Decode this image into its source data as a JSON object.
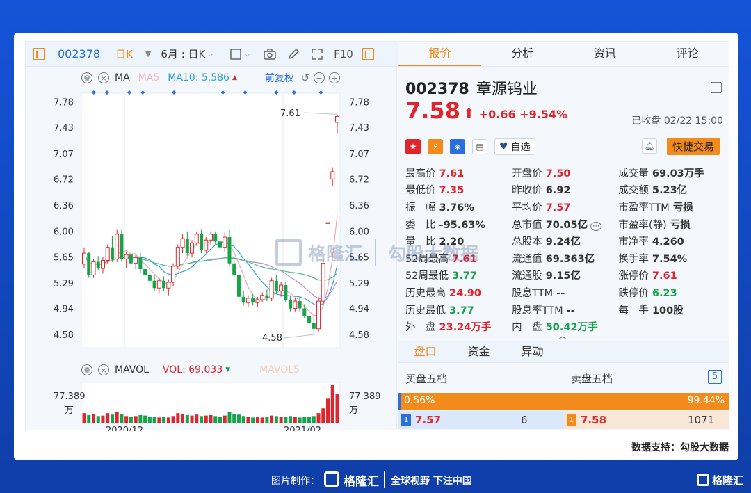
{
  "toolbar": {
    "code": "002378",
    "period": "日K",
    "range": "6月 : 日K",
    "f10": "F10"
  },
  "ma_bar": {
    "label": "MA",
    "ma5": "MA5",
    "ma10": "MA10: 5.586",
    "restore": "前复权"
  },
  "vol_bar": {
    "label": "MAVOL",
    "vol": "VOL: 69.033",
    "mavol5": "MAVOL5"
  },
  "chart_data": {
    "type": "candlestick",
    "y_ticks": [
      "7.78",
      "7.43",
      "7.07",
      "6.72",
      "6.36",
      "6.00",
      "5.65",
      "5.29",
      "4.94",
      "4.58"
    ],
    "ylim": [
      4.4,
      7.9
    ],
    "x_labels": [
      "2020/12",
      "2021/02"
    ],
    "annot_high": "7.61",
    "annot_low": "4.58",
    "vol_tick": "77.389",
    "vol_unit": "万",
    "candles": [
      [
        5.55,
        5.78,
        5.49,
        5.7
      ],
      [
        5.7,
        5.72,
        5.36,
        5.4
      ],
      [
        5.4,
        5.62,
        5.36,
        5.58
      ],
      [
        5.58,
        5.66,
        5.46,
        5.49
      ],
      [
        5.49,
        5.65,
        5.42,
        5.6
      ],
      [
        5.6,
        5.82,
        5.56,
        5.78
      ],
      [
        5.78,
        5.94,
        5.58,
        5.62
      ],
      [
        5.62,
        6.02,
        5.58,
        5.96
      ],
      [
        5.96,
        6.02,
        5.58,
        5.62
      ],
      [
        5.62,
        5.72,
        5.5,
        5.68
      ],
      [
        5.68,
        5.75,
        5.52,
        5.56
      ],
      [
        5.56,
        5.68,
        5.48,
        5.64
      ],
      [
        5.64,
        5.7,
        5.42,
        5.48
      ],
      [
        5.48,
        5.55,
        5.36,
        5.4
      ],
      [
        5.4,
        5.5,
        5.28,
        5.32
      ],
      [
        5.32,
        5.4,
        5.18,
        5.22
      ],
      [
        5.22,
        5.36,
        5.14,
        5.32
      ],
      [
        5.32,
        5.38,
        5.18,
        5.22
      ],
      [
        5.22,
        5.34,
        5.12,
        5.3
      ],
      [
        5.3,
        5.56,
        5.24,
        5.52
      ],
      [
        5.52,
        5.82,
        5.48,
        5.78
      ],
      [
        5.78,
        5.96,
        5.7,
        5.9
      ],
      [
        5.9,
        6.0,
        5.66,
        5.7
      ],
      [
        5.7,
        5.88,
        5.64,
        5.84
      ],
      [
        5.84,
        6.0,
        5.8,
        5.96
      ],
      [
        5.96,
        6.02,
        5.7,
        5.74
      ],
      [
        5.74,
        5.92,
        5.7,
        5.88
      ],
      [
        5.88,
        6.0,
        5.82,
        5.96
      ],
      [
        5.96,
        6.0,
        5.82,
        5.86
      ],
      [
        5.86,
        5.94,
        5.74,
        5.78
      ],
      [
        5.78,
        5.98,
        5.72,
        5.92
      ],
      [
        5.92,
        6.02,
        5.52,
        5.56
      ],
      [
        5.56,
        5.6,
        5.36,
        5.4
      ],
      [
        5.4,
        5.44,
        5.06,
        5.1
      ],
      [
        5.1,
        5.18,
        4.98,
        5.02
      ],
      [
        5.02,
        5.12,
        4.96,
        5.08
      ],
      [
        5.08,
        5.14,
        4.98,
        5.02
      ],
      [
        5.02,
        5.1,
        4.96,
        5.06
      ],
      [
        5.06,
        5.16,
        5.02,
        5.12
      ],
      [
        5.12,
        5.2,
        5.04,
        5.08
      ],
      [
        5.08,
        5.36,
        5.04,
        5.32
      ],
      [
        5.32,
        5.4,
        5.14,
        5.18
      ],
      [
        5.18,
        5.3,
        5.1,
        5.26
      ],
      [
        5.26,
        5.3,
        5.02,
        5.06
      ],
      [
        5.06,
        5.12,
        4.9,
        4.94
      ],
      [
        4.94,
        5.08,
        4.9,
        5.04
      ],
      [
        5.04,
        5.1,
        4.9,
        4.94
      ],
      [
        4.94,
        5.0,
        4.8,
        4.84
      ],
      [
        4.84,
        4.92,
        4.7,
        4.74
      ],
      [
        4.74,
        4.84,
        4.58,
        4.66
      ],
      [
        4.66,
        5.1,
        4.62,
        5.04
      ],
      [
        5.04,
        5.62,
        5.0,
        5.56
      ],
      [
        6.12,
        6.14,
        6.1,
        6.12
      ],
      [
        6.72,
        6.88,
        6.62,
        6.82
      ],
      [
        7.5,
        7.61,
        7.35,
        7.58
      ]
    ],
    "volumes": [
      20,
      16,
      18,
      14,
      15,
      20,
      17,
      22,
      18,
      14,
      13,
      14,
      16,
      15,
      13,
      12,
      11,
      12,
      11,
      14,
      20,
      18,
      16,
      15,
      17,
      14,
      15,
      16,
      14,
      13,
      15,
      22,
      18,
      17,
      14,
      12,
      11,
      12,
      11,
      12,
      15,
      14,
      12,
      13,
      14,
      12,
      11,
      13,
      12,
      14,
      20,
      30,
      50,
      78,
      60
    ]
  },
  "tabs": [
    "报价",
    "分析",
    "资讯",
    "评论"
  ],
  "stock": {
    "code": "002378",
    "name": "章源钨业",
    "price": "7.58",
    "arrow": "⬆",
    "change": "+0.66 +9.54%",
    "closed": "已收盘 02/22 15:00",
    "fav": "自选",
    "trade": "快捷交易"
  },
  "quote_grid": [
    [
      [
        "最高价",
        "7.61",
        "up"
      ],
      [
        "开盘价",
        "7.50",
        "up"
      ],
      [
        "成交量",
        "69.03万手",
        "bold"
      ]
    ],
    [
      [
        "最低价",
        "7.35",
        "up"
      ],
      [
        "昨收价",
        "6.92",
        "bold"
      ],
      [
        "成交额",
        "5.23亿",
        "bold"
      ]
    ],
    [
      [
        "振　幅",
        "3.76%",
        "bold"
      ],
      [
        "平均价",
        "7.57",
        "up"
      ],
      [
        "市盈率TTM",
        "亏损",
        "bold"
      ]
    ],
    [
      [
        "委　比",
        "-95.63%",
        "bold"
      ],
      [
        "总市值",
        "70.05亿",
        "bold"
      ],
      [
        "市盈率(静)",
        "亏损",
        "bold"
      ]
    ],
    [
      [
        "量　比",
        "2.20",
        "bold"
      ],
      [
        "总股本",
        "9.24亿",
        "bold"
      ],
      [
        "市净率",
        "4.260",
        "bold"
      ]
    ],
    [
      [
        "52周最高",
        "7.61",
        "up"
      ],
      [
        "流通值",
        "69.363亿",
        "bold"
      ],
      [
        "换手率",
        "7.54%",
        "bold"
      ]
    ],
    [
      [
        "52周最低",
        "3.77",
        "dn"
      ],
      [
        "流通股",
        "9.15亿",
        "bold"
      ],
      [
        "涨停价",
        "7.61",
        "up"
      ]
    ],
    [
      [
        "历史最高",
        "24.90",
        "up"
      ],
      [
        "股息TTM",
        "--",
        "bold"
      ],
      [
        "跌停价",
        "6.23",
        "dn"
      ]
    ],
    [
      [
        "历史最低",
        "3.77",
        "dn"
      ],
      [
        "股息率TTM",
        "--",
        "bold"
      ],
      [
        "每　手",
        "100股",
        "bold"
      ]
    ],
    [
      [
        "外　盘",
        "23.24万手",
        "up"
      ],
      [
        "内　盘",
        "50.42万手",
        "dn"
      ],
      [
        "",
        "",
        " "
      ]
    ]
  ],
  "subtabs": [
    "盘口",
    "资金",
    "异动"
  ],
  "orders": {
    "buy_title": "买盘五档",
    "sell_title": "卖盘五档",
    "five": "5",
    "buy_pct": "0.56%",
    "sell_pct": "99.44%",
    "bid_level": "1",
    "bid_price": "7.57",
    "bid_vol": "6",
    "ask_level": "1",
    "ask_price": "7.58",
    "ask_vol": "1071",
    "buy_ratio": 0.0056
  },
  "footer": {
    "support": "数据支持：勾股大数据",
    "made_by": "图片制作：",
    "brand": "格隆汇",
    "slogan": "全球视野 下注中国",
    "corner_brand": "格隆汇"
  },
  "watermark": {
    "brand": "格隆汇",
    "partner": "勾股大数据"
  },
  "colors": {
    "up": "#e0262d",
    "down": "#16a34a",
    "accent": "#f28a1c",
    "blue": "#2a6fdb"
  }
}
